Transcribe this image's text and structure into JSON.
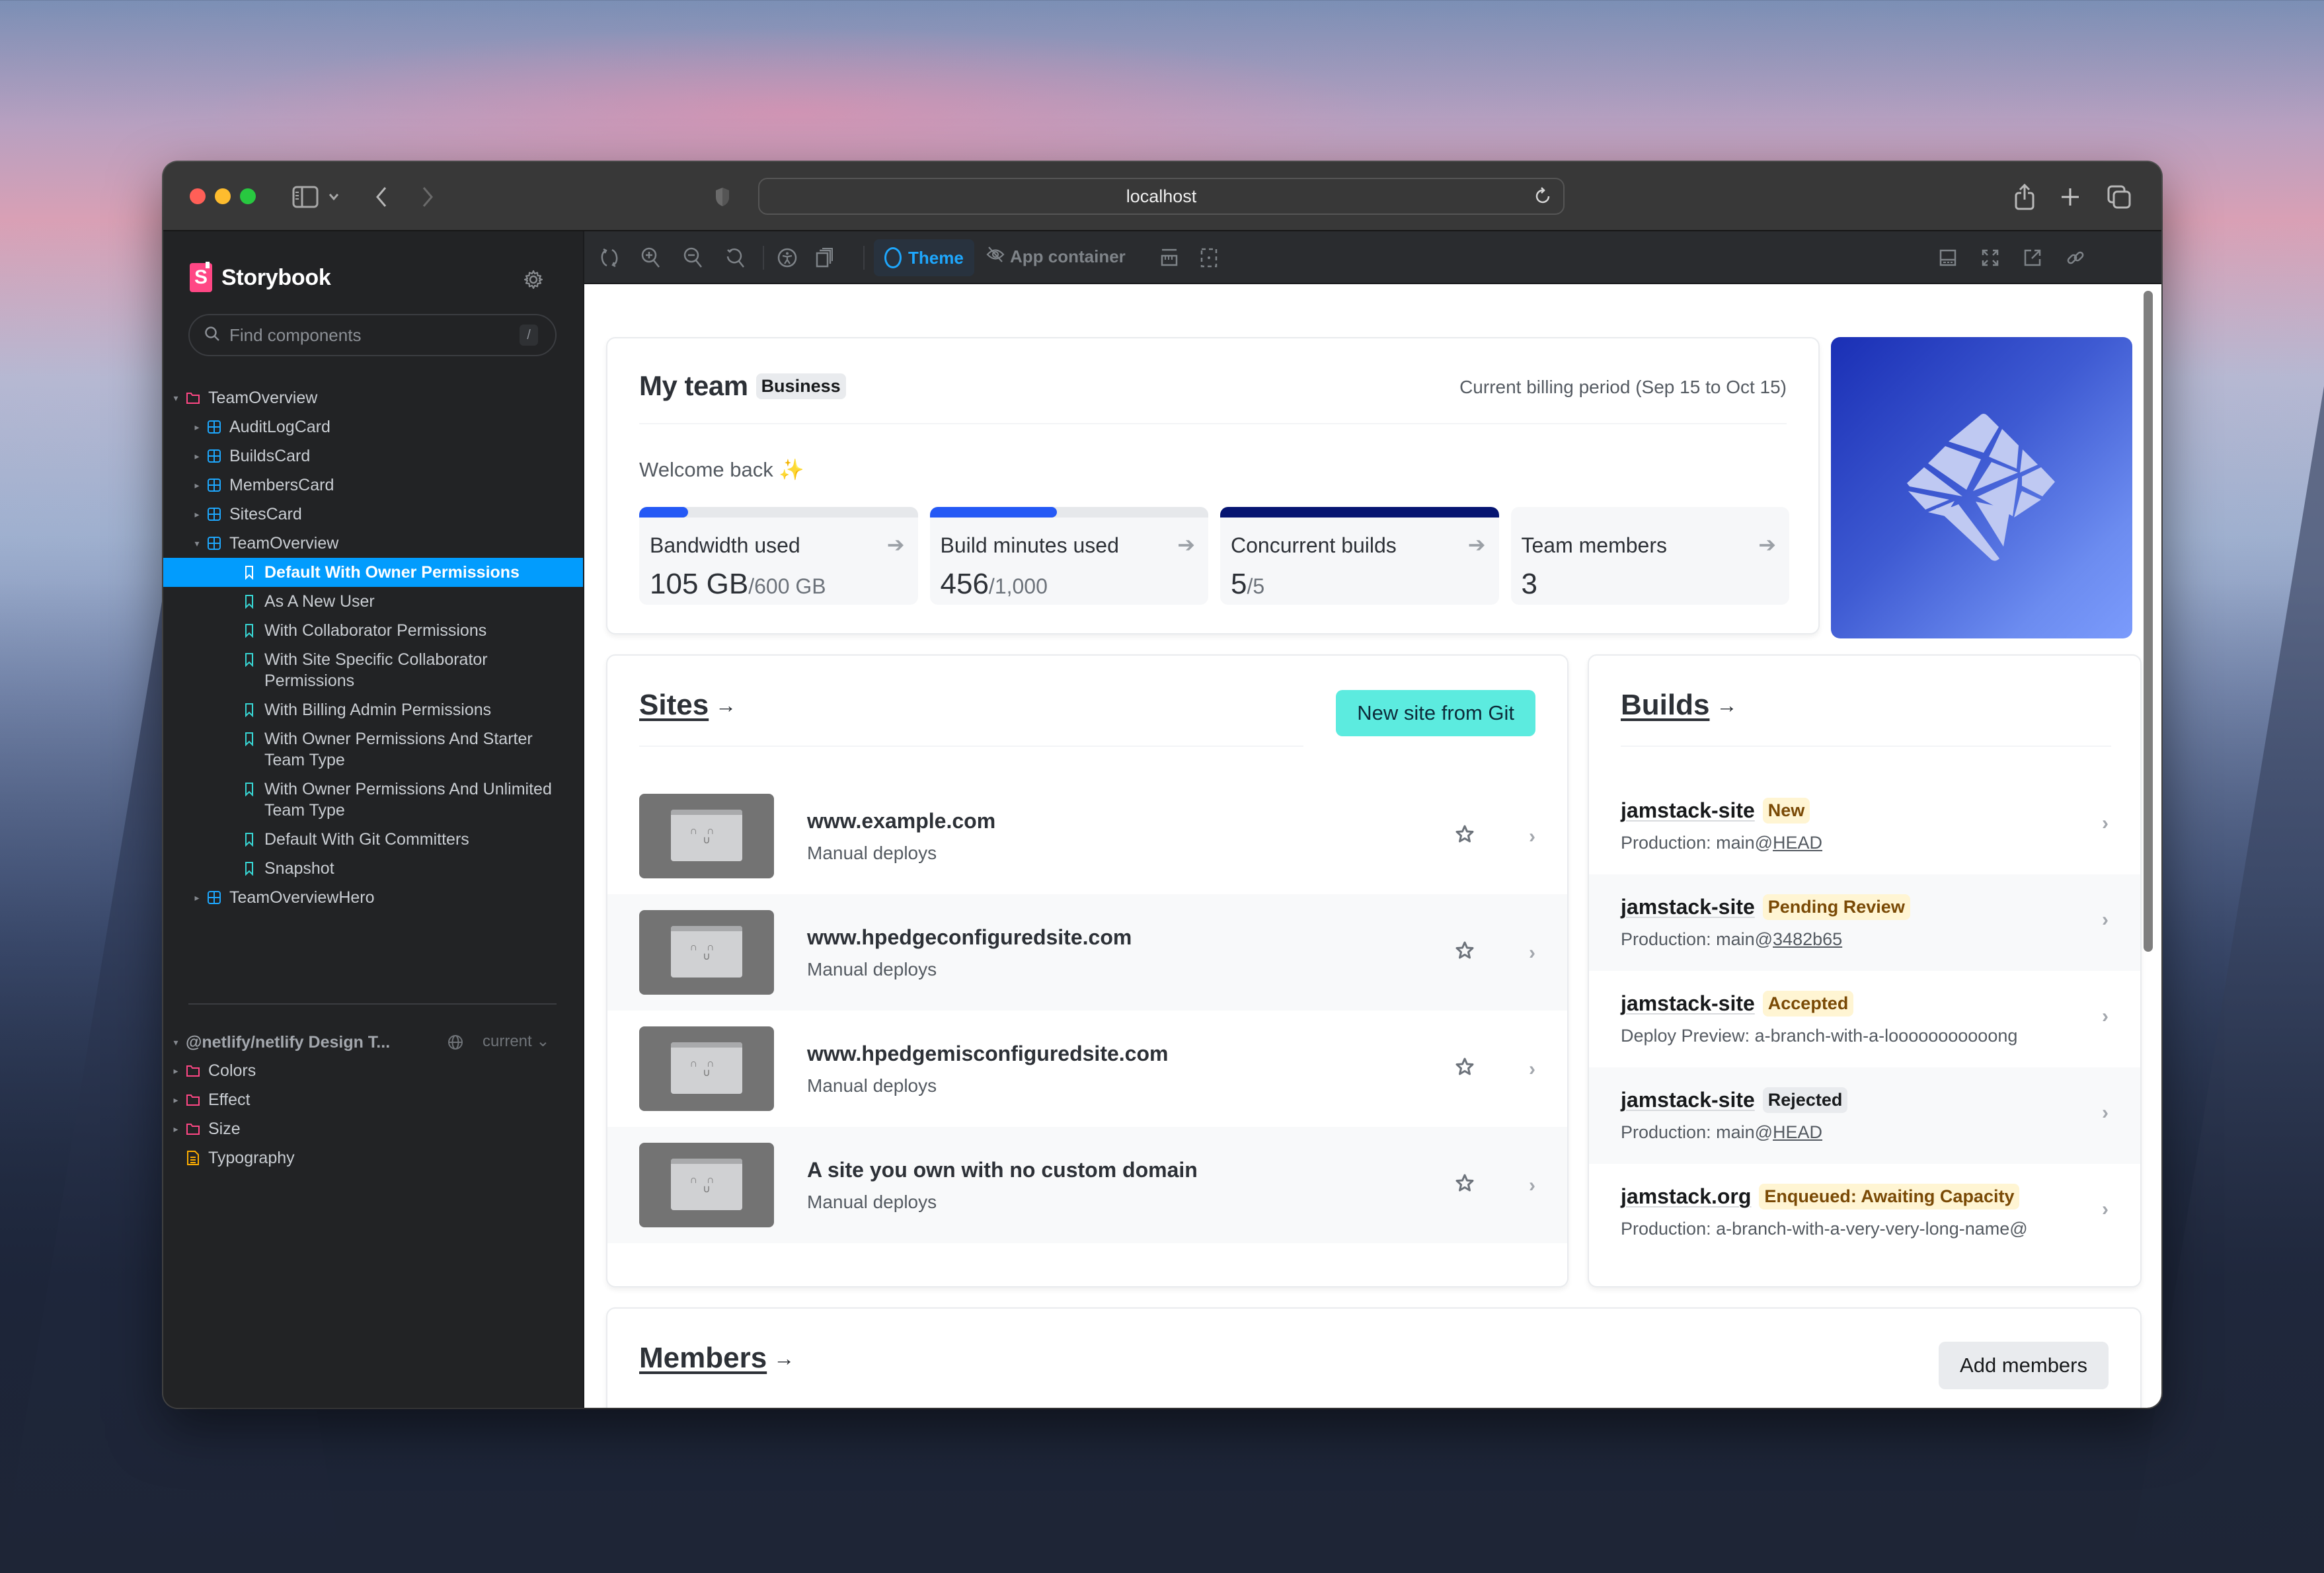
{
  "browser": {
    "url": "localhost"
  },
  "sidebar": {
    "brand": "Storybook",
    "search_placeholder": "Find components",
    "search_shortcut": "/",
    "tree": [
      {
        "label": "TeamOverview",
        "level": 0,
        "type": "folder",
        "expanded": true
      },
      {
        "label": "AuditLogCard",
        "level": 1,
        "type": "component",
        "expanded": false
      },
      {
        "label": "BuildsCard",
        "level": 1,
        "type": "component",
        "expanded": false
      },
      {
        "label": "MembersCard",
        "level": 1,
        "type": "component",
        "expanded": false
      },
      {
        "label": "SitesCard",
        "level": 1,
        "type": "component",
        "expanded": false
      },
      {
        "label": "TeamOverview",
        "level": 1,
        "type": "component",
        "expanded": true
      },
      {
        "label": "Default With Owner Permissions",
        "level": 2,
        "type": "story",
        "selected": true
      },
      {
        "label": "As A New User",
        "level": 2,
        "type": "story"
      },
      {
        "label": "With Collaborator Permissions",
        "level": 2,
        "type": "story"
      },
      {
        "label": "With Site Specific Collaborator Permissions",
        "level": 2,
        "type": "story"
      },
      {
        "label": "With Billing Admin Permissions",
        "level": 2,
        "type": "story"
      },
      {
        "label": "With Owner Permissions And Starter Team Type",
        "level": 2,
        "type": "story"
      },
      {
        "label": "With Owner Permissions And Unlimited Team Type",
        "level": 2,
        "type": "story"
      },
      {
        "label": "Default With Git Committers",
        "level": 2,
        "type": "story"
      },
      {
        "label": "Snapshot",
        "level": 2,
        "type": "story"
      },
      {
        "label": "TeamOverviewHero",
        "level": 1,
        "type": "component",
        "expanded": false
      }
    ],
    "design_system": {
      "title": "@netlify/netlify Design T...",
      "version": "current",
      "items": [
        {
          "label": "Colors",
          "type": "folder"
        },
        {
          "label": "Effect",
          "type": "folder"
        },
        {
          "label": "Size",
          "type": "folder"
        },
        {
          "label": "Typography",
          "type": "doc"
        }
      ]
    }
  },
  "toolbar": {
    "theme_label": "Theme",
    "app_container_label": "App container"
  },
  "team": {
    "title": "My team",
    "plan": "Business",
    "billing_period": "Current billing period (Sep 15 to Oct 15)",
    "welcome": "Welcome back",
    "welcome_emoji": "✨",
    "stats": [
      {
        "label": "Bandwidth used",
        "value": "105 GB",
        "max": "/600 GB",
        "progress": 0.175,
        "bar_color": "#2559f5"
      },
      {
        "label": "Build minutes used",
        "value": "456",
        "max": "/1,000",
        "progress": 0.456,
        "bar_color": "#2559f5"
      },
      {
        "label": "Concurrent builds",
        "value": "5",
        "max": "/5",
        "progress": 1.0,
        "bar_color": "#061572"
      },
      {
        "label": "Team members",
        "value": "3",
        "max": "",
        "progress": null
      }
    ]
  },
  "sites": {
    "title": "Sites",
    "new_button": "New site from Git",
    "items": [
      {
        "name": "www.example.com",
        "sub": "Manual deploys"
      },
      {
        "name": "www.hpedgeconfiguredsite.com",
        "sub": "Manual deploys"
      },
      {
        "name": "www.hpedgemisconfiguredsite.com",
        "sub": "Manual deploys"
      },
      {
        "name": "A site you own with no custom domain",
        "sub": "Manual deploys"
      }
    ]
  },
  "builds": {
    "title": "Builds",
    "items": [
      {
        "site": "jamstack-site",
        "status": "New",
        "status_tone": "warning",
        "context": "Production: ",
        "branch": "main@",
        "ref": "HEAD"
      },
      {
        "site": "jamstack-site",
        "status": "Pending Review",
        "status_tone": "warning",
        "context": "Production: ",
        "branch": "main@",
        "ref": "3482b65"
      },
      {
        "site": "jamstack-site",
        "status": "Accepted",
        "status_tone": "warning",
        "context": "Deploy Preview: ",
        "branch": "a-branch-with-a-looooooooooong",
        "ref": ""
      },
      {
        "site": "jamstack-site",
        "status": "Rejected",
        "status_tone": "neutral",
        "context": "Production: ",
        "branch": "main@",
        "ref": "HEAD"
      },
      {
        "site": "jamstack.org",
        "status": "Enqueued: Awaiting Capacity",
        "status_tone": "warning",
        "context": "Production: ",
        "branch": "a-branch-with-a-very-very-long-name@",
        "ref": ""
      }
    ]
  },
  "members": {
    "title": "Members",
    "add_button": "Add members"
  },
  "colors": {
    "storybook_accent": "#029cfd",
    "storybook_pink": "#ff4785",
    "teal_button": "#5cebdf",
    "progress_blue": "#2559f5",
    "progress_navy": "#061572",
    "status_warning_bg": "#fff5d3",
    "status_warning_text": "#7a4a06"
  }
}
